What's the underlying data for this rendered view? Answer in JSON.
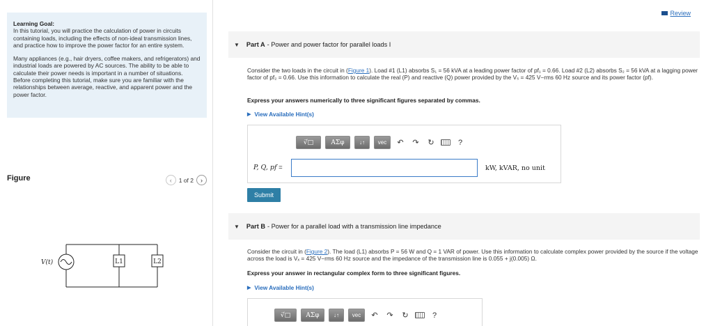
{
  "goal": {
    "title": "Learning Goal:",
    "p1": "In this tutorial, you will practice the calculation of power in circuits containing loads, including the effects of non-ideal transmission lines, and practice how to improve the power factor for an entire system.",
    "p2": "Many appliances (e.g., hair dryers, coffee makers, and refrigerators) and industrial loads are powered by AC sources. The ability to be able to calculate their power needs is important in a number of situations. Before completing this tutorial, make sure you are familiar with the relationships between average, reactive, and apparent power and the power factor."
  },
  "figure": {
    "title": "Figure",
    "pager": "1 of 2",
    "labels": {
      "source": "V(t)",
      "load1": "L1",
      "load2": "L2"
    }
  },
  "review": {
    "label": "Review"
  },
  "partA": {
    "letter": "Part A",
    "title": " - Power and power factor for parallel loads I",
    "text_1": "Consider the two loads in the circuit in (",
    "link": "Figure 1",
    "text_2": "). Load #1 (L1) absorbs S₁ = 56 kVA at a leading power factor of pf₁ = 0.66. Load #2 (L2) absorbs S₂ = 56 kVA at a lagging power factor of pf₂ = 0.66. Use this information to calculate the real (P) and reactive (Q) power provided by the Vₛ = 425 V−rms 60 Hz source and its power factor (pf).",
    "instruction": "Express your answers numerically to three significant figures separated by commas.",
    "hint": "View Available Hint(s)",
    "variable": "P, Q, pf",
    "eq": " = ",
    "units": "kW, kVAR, no unit",
    "submit": "Submit"
  },
  "partB": {
    "letter": "Part B",
    "title": " - Power for a parallel load with a transmission line impedance",
    "text_1": "Consider the circuit in (",
    "link": "Figure 2",
    "text_2": "). The load (L1) absorbs P = 56 W and Q = 1 VAR of power. Use this information to calculate complex power provided by the source if the voltage across the load is Vₓ = 425 V−rms 60 Hz source and the impedance of the transmission line is 0.055 + j(0.005) Ω.",
    "instruction": "Express your answer in rectangular complex form to three significant figures.",
    "hint": "View Available Hint(s)"
  },
  "toolbar": {
    "templates": "√̅",
    "greek": "ΑΣφ",
    "sort": "↓↑",
    "vec": "vec",
    "undo": "↶",
    "redo": "↷",
    "reset": "↻",
    "help": "?"
  },
  "colors": {
    "accent": "#2a6ebd",
    "goal_bg": "#e8f1f8",
    "submit": "#2e7fa6"
  }
}
